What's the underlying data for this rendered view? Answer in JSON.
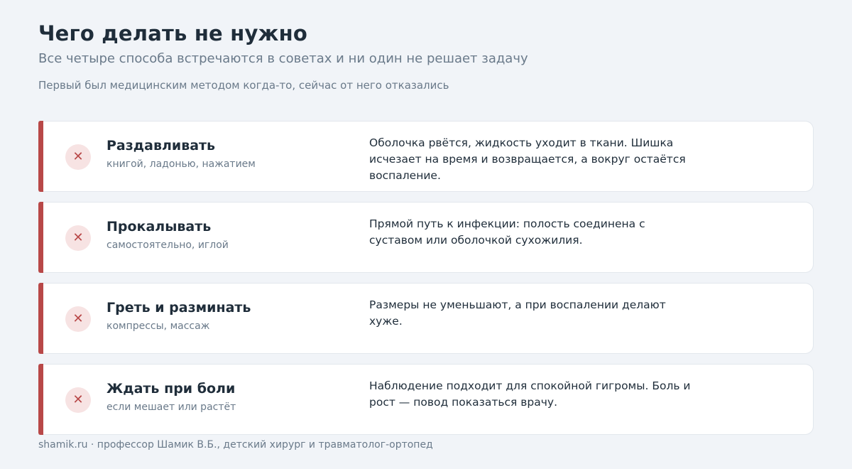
{
  "header": {
    "title": "Чего делать не нужно",
    "subtitle": "Все четыре способа встречаются в советах и ни один не решает задачу",
    "note": "Первый был медицинским методом когда-то, сейчас от него отказались"
  },
  "colors": {
    "accent": "#b84848",
    "badge_bg": "#f7e3e3",
    "background": "#f1f4f8",
    "card_bg": "#ffffff"
  },
  "icons": {
    "status": "close-icon",
    "glyph": "✕"
  },
  "cards": [
    {
      "title": "Раздавливать",
      "subtitle": "книгой, ладонью, нажатием",
      "description": "Оболочка рвётся, жидкость уходит в ткани. Шишка исчезает на время и возвращается, а вокруг остаётся воспаление."
    },
    {
      "title": "Прокалывать",
      "subtitle": "самостоятельно, иглой",
      "description": "Прямой путь к инфекции: полость соединена с суставом или оболочкой сухожилия."
    },
    {
      "title": "Греть и разминать",
      "subtitle": "компрессы, массаж",
      "description": "Размеры не уменьшают, а при воспалении делают хуже."
    },
    {
      "title": "Ждать при боли",
      "subtitle": "если мешает или растёт",
      "description": "Наблюдение подходит для спокойной гигромы. Боль и рост — повод показаться врачу."
    }
  ],
  "footer": {
    "text": "shamik.ru · профессор Шамик В.Б., детский хирург и травматолог-ортопед"
  }
}
